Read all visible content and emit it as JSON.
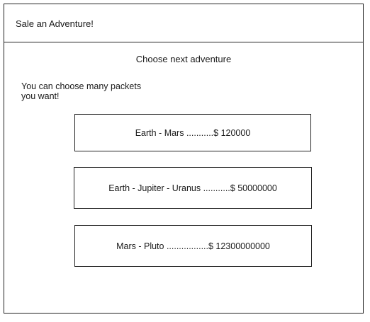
{
  "header": {
    "title": "Sale an Adventure!"
  },
  "main": {
    "subtitle": "Choose next adventure",
    "note": "You can choose many packets you want!",
    "packets": [
      {
        "label": "Earth - Mars ...........$ 120000"
      },
      {
        "label": "Earth - Jupiter - Uranus ...........$ 50000000"
      },
      {
        "label": "Mars - Pluto .................$ 12300000000"
      }
    ]
  }
}
